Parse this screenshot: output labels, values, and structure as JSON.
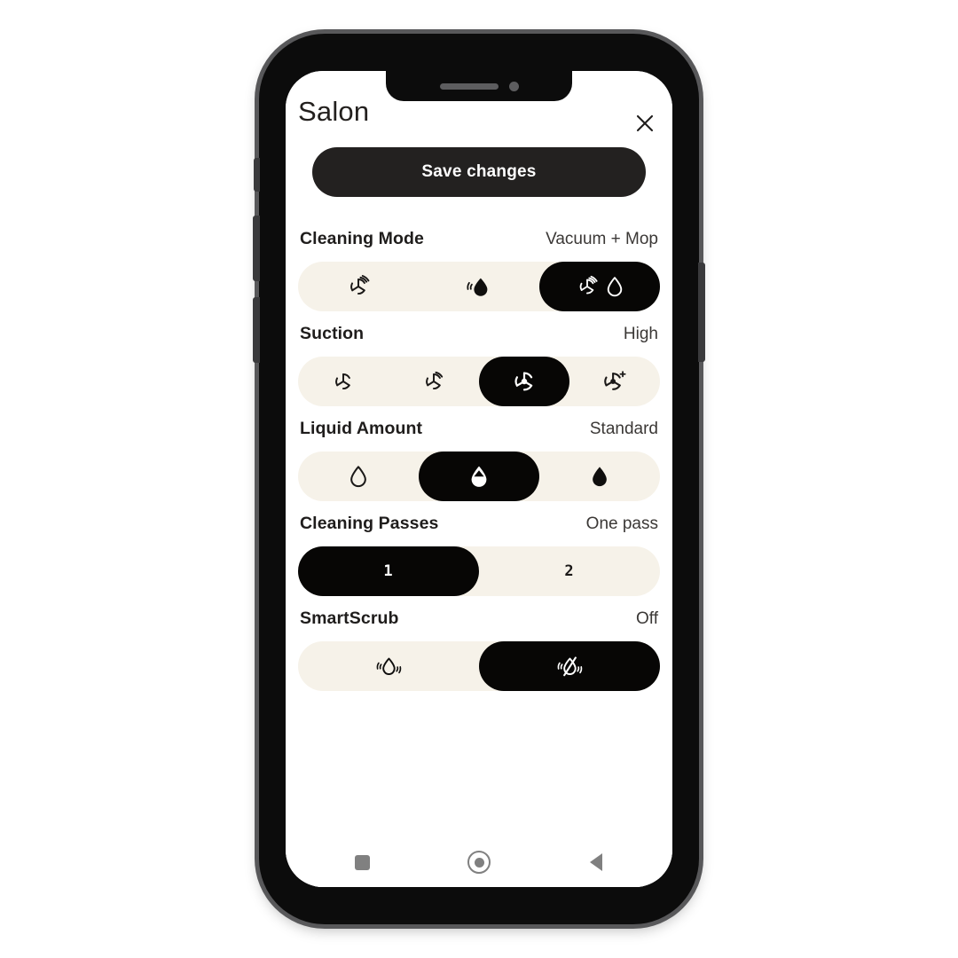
{
  "app": {
    "title": "Salon",
    "close_icon": "close-icon",
    "save_label": "Save changes"
  },
  "colors": {
    "selected_pill": "#070605",
    "track": "#f6f2e9",
    "accent_dark": "#232120",
    "text": "#1f1d1c",
    "nav_icon": "#808080"
  },
  "settings": [
    {
      "key": "cleaning-mode",
      "label": "Cleaning Mode",
      "value": "Vacuum + Mop",
      "options": [
        {
          "name": "vacuum",
          "icon": "fan-icon",
          "selected": false
        },
        {
          "name": "mop",
          "icon": "water-drop-icon",
          "selected": false
        },
        {
          "name": "vacuum-and-mop",
          "icon": "fan-and-drop-icon",
          "selected": true
        }
      ]
    },
    {
      "key": "suction",
      "label": "Suction",
      "value": "High",
      "options": [
        {
          "name": "quiet",
          "icon": "fan-quiet-icon",
          "selected": false
        },
        {
          "name": "standard",
          "icon": "fan-standard-icon",
          "selected": false
        },
        {
          "name": "high",
          "icon": "fan-high-icon",
          "selected": true
        },
        {
          "name": "turbo",
          "icon": "fan-turbo-plus-icon",
          "selected": false
        }
      ]
    },
    {
      "key": "liquid-amount",
      "label": "Liquid Amount",
      "value": "Standard",
      "options": [
        {
          "name": "low",
          "icon": "drop-outline-icon",
          "selected": false
        },
        {
          "name": "standard",
          "icon": "drop-half-filled-icon",
          "selected": true
        },
        {
          "name": "high",
          "icon": "drop-filled-icon",
          "selected": false
        }
      ]
    },
    {
      "key": "cleaning-passes",
      "label": "Cleaning Passes",
      "value": "One pass",
      "options": [
        {
          "name": "one-pass",
          "text": "1",
          "selected": true
        },
        {
          "name": "two-passes",
          "text": "2",
          "selected": false
        }
      ]
    },
    {
      "key": "smartscrub",
      "label": "SmartScrub",
      "value": "Off",
      "options": [
        {
          "name": "smartscrub-on",
          "icon": "scrub-drop-icon",
          "selected": false
        },
        {
          "name": "smartscrub-off",
          "icon": "scrub-drop-off-icon",
          "selected": true
        }
      ]
    }
  ],
  "nav_bar": {
    "recents": "square-recents-icon",
    "home": "circle-home-icon",
    "back": "triangle-back-icon"
  }
}
